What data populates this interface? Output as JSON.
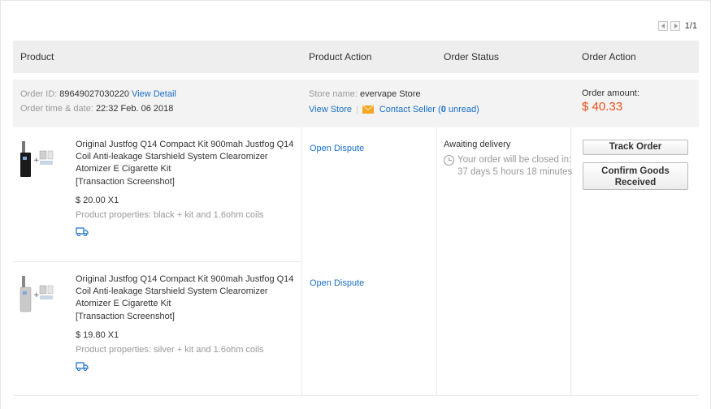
{
  "pager": {
    "count": "1/1"
  },
  "header": {
    "product": "Product",
    "product_action": "Product Action",
    "order_status": "Order Status",
    "order_action": "Order Action"
  },
  "order": {
    "id_label": "Order ID:",
    "id_value": "89649027030220",
    "view_detail": "View Detail",
    "time_label": "Order time & date:",
    "time_value": "22:32 Feb. 06 2018",
    "store_label": "Store name:",
    "store_value": "evervape Store",
    "view_store": "View Store",
    "separator": "|",
    "contact_seller": "Contact Seller",
    "unread_count": "0",
    "unread_label": "unread",
    "amount_label": "Order amount:",
    "amount_value": "$ 40.33"
  },
  "items": [
    {
      "title": "Original Justfog Q14 Compact Kit 900mah Justfog Q14 Coil Anti-leakage Starshield System Clearomizer Atomizer E Cigarette Kit",
      "screenshot": "[Transaction Screenshot]",
      "price": "$ 20.00 X1",
      "properties": "Product properties: black + kit and 1.6ohm coils",
      "action": "Open Dispute",
      "color": "#1a1a1a"
    },
    {
      "title": "Original Justfog Q14 Compact Kit 900mah Justfog Q14 Coil Anti-leakage Starshield System Clearomizer Atomizer E Cigarette Kit",
      "screenshot": "[Transaction Screenshot]",
      "price": "$ 19.80 X1",
      "properties": "Product properties: silver + kit and 1.6ohm coils",
      "action": "Open Dispute",
      "color": "#c9c9c9"
    }
  ],
  "status": {
    "title": "Awaiting delivery",
    "detail": "Your order will be closed in: 37 days 5 hours 18 minutes"
  },
  "actions": {
    "track": "Track Order",
    "confirm": "Confirm Goods Received"
  },
  "colors": {
    "link": "#1a6fc9",
    "amount": "#e8501d",
    "header_bg": "#eeeeee"
  }
}
